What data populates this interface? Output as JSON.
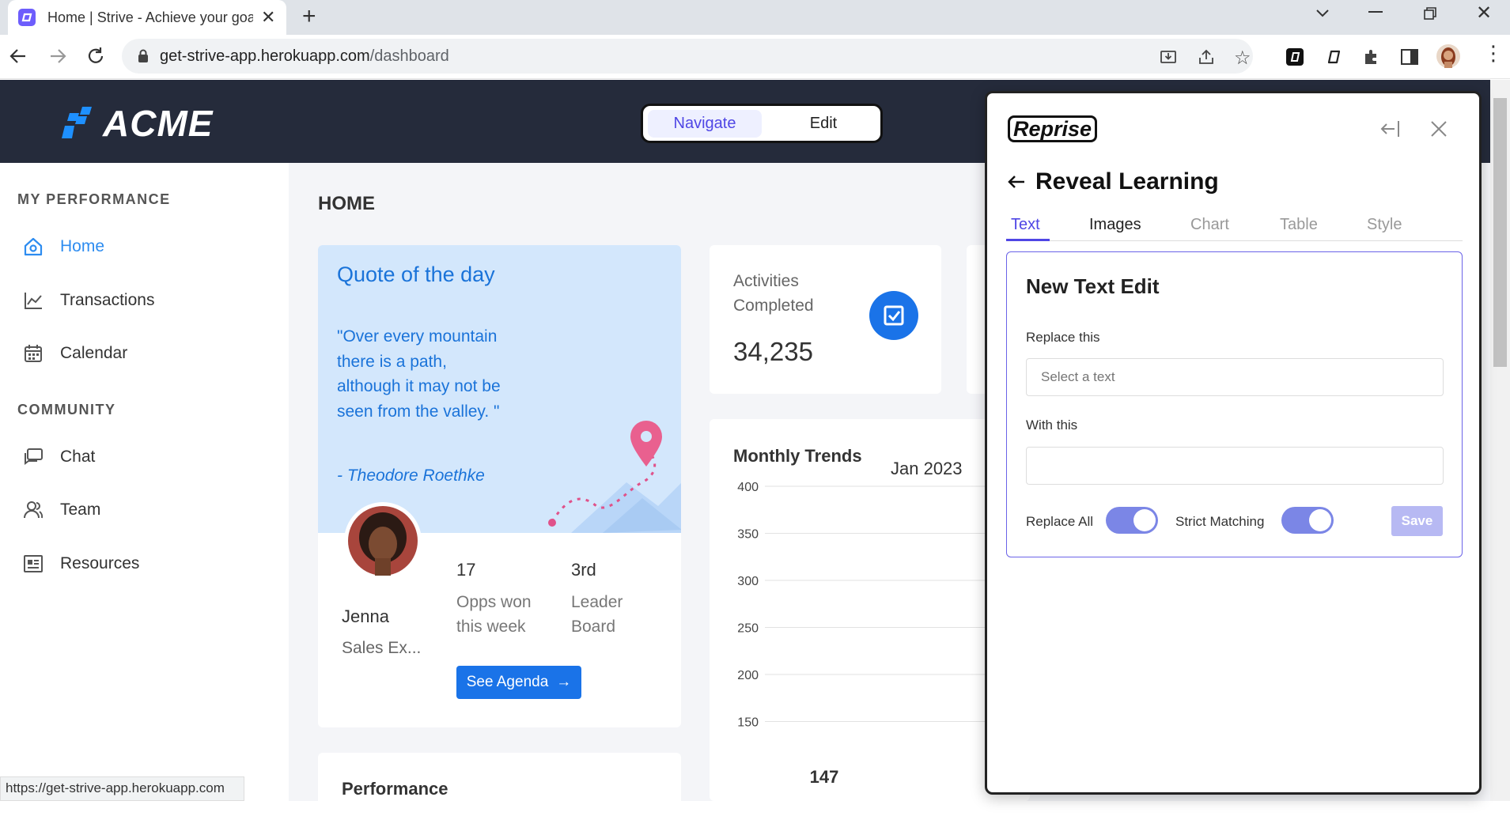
{
  "browser": {
    "tab_title": "Home | Strive - Achieve your goa",
    "url_host": "get-strive-app.herokuapp.com",
    "url_path": "/dashboard",
    "status_url": "https://get-strive-app.herokuapp.com"
  },
  "header": {
    "logo_text": "ACME",
    "mode_navigate": "Navigate",
    "mode_edit": "Edit"
  },
  "sidebar": {
    "section_performance": "MY PERFORMANCE",
    "section_community": "COMMUNITY",
    "items": [
      {
        "label": "Home",
        "icon": "home-icon"
      },
      {
        "label": "Transactions",
        "icon": "chart-line-icon"
      },
      {
        "label": "Calendar",
        "icon": "calendar-icon"
      },
      {
        "label": "Chat",
        "icon": "chat-icon"
      },
      {
        "label": "Team",
        "icon": "team-icon"
      },
      {
        "label": "Resources",
        "icon": "resources-icon"
      }
    ]
  },
  "main": {
    "page_title": "HOME",
    "quote": {
      "title": "Quote of the day",
      "text": "\"Over every mountain there is a path, although it may not be seen from the valley. \"",
      "author": "- Theodore Roethke"
    },
    "profile": {
      "name": "Jenna",
      "role": "Sales Ex...",
      "opps_value": "17",
      "opps_label": "Opps won this week",
      "rank_value": "3rd",
      "rank_label": "Leader Board",
      "agenda_button": "See Agenda"
    },
    "activities": {
      "label": "Activities Completed",
      "value": "34,235"
    },
    "trends": {
      "title": "Monthly Trends",
      "period": "Jan 2023"
    },
    "performance_title": "Performance"
  },
  "chart_data": {
    "type": "bar",
    "title": "Monthly Trends",
    "yticks": [
      400,
      350,
      300,
      250,
      200,
      150
    ],
    "ylim": [
      150,
      400
    ],
    "visible_value_labels": [
      "147"
    ]
  },
  "panel": {
    "brand": "Reprise",
    "title": "Reveal Learning",
    "tabs": [
      "Text",
      "Images",
      "Chart",
      "Table",
      "Style"
    ],
    "active_tab": "Text",
    "form_title": "New Text Edit",
    "replace_label": "Replace this",
    "replace_placeholder": "Select a text",
    "with_label": "With this",
    "with_value": "",
    "replace_all_label": "Replace All",
    "strict_label": "Strict Matching",
    "save_label": "Save",
    "accent": "#4f46e5"
  }
}
